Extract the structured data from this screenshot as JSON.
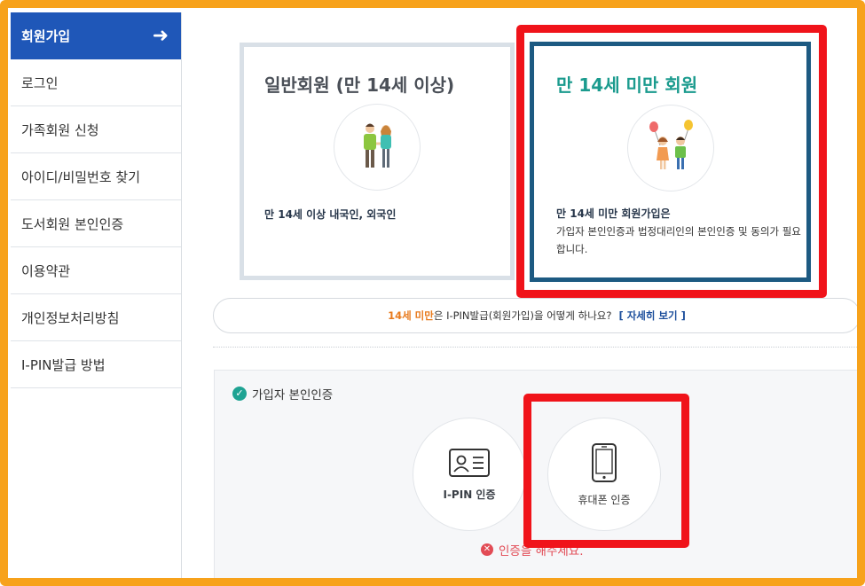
{
  "sidebar": {
    "header": "회원가입",
    "items": [
      {
        "label": "로그인"
      },
      {
        "label": "가족회원 신청"
      },
      {
        "label": "아이디/비밀번호 찾기"
      },
      {
        "label": "도서회원 본인인증"
      },
      {
        "label": "이용약관"
      },
      {
        "label": "개인정보처리방침"
      },
      {
        "label": "I-PIN발급 방법"
      }
    ]
  },
  "cards": {
    "general": {
      "title": "일반회원 (만 14세 이상)",
      "desc": "만 14세 이상 내국인, 외국인"
    },
    "minor": {
      "title": "만 14세 미만 회원",
      "desc": "만 14세 미만 회원가입은",
      "sub": "가입자 본인인증과 법정대리인의 본인인증 및 동의가 필요합니다."
    }
  },
  "info": {
    "highlight": "14세 미만",
    "text": "은 I-PIN발급(회원가입)을 어떻게 하나요?",
    "link": "[ 자세히 보기 ]"
  },
  "verify": {
    "title": "가입자 본인인증",
    "ipin_label": "I-PIN 인증",
    "phone_label": "휴대폰 인증",
    "error": "인증을 해주세요."
  },
  "colors": {
    "frame": "#f7a21b",
    "sidebar_head": "#1f57b8",
    "minor_border": "#1d5a82",
    "minor_title": "#1b9b8e",
    "highlight": "#f0131a"
  }
}
